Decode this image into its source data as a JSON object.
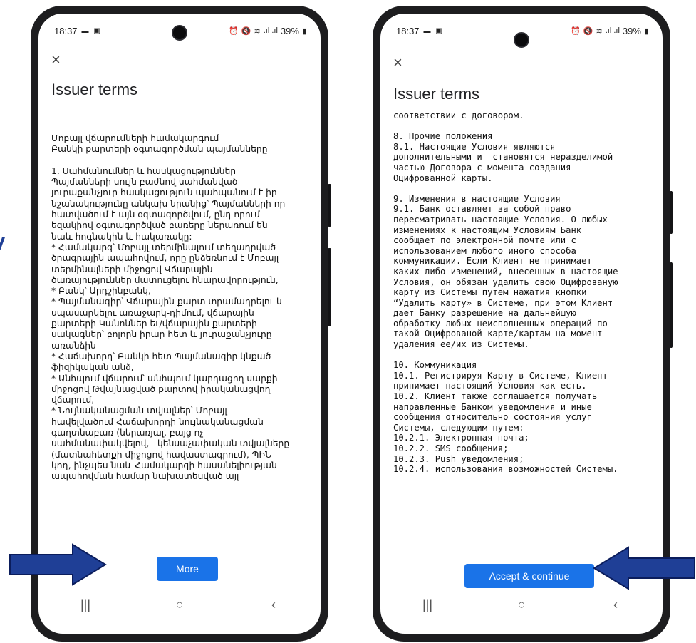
{
  "colors": {
    "accent": "#1a73e8",
    "arrow_fill": "#1f3f96",
    "arrow_stroke": "#0b1d5c"
  },
  "left_phone": {
    "status": {
      "time": "18:37",
      "battery": "39%"
    },
    "close_icon": "×",
    "title": "Issuer terms",
    "body": "Մոբայլ վճարումների համակարգում\nԲանկի քարտերի օգտագործման պայմանները\n\n1. Սահմանումներ և հասկացություններ\nՊայմանների սույն բաժնով սահմանված\nյուրաքանչյուր հասկացություն պահպանում է իր\nնշանակությունը անկախ նրանից՝ Պայմանների որ\nհատվածում է այն օգտագործվում, ընդ որում\nեզակիով օգտագործված բառերը ներառում են\nնաև հոգնակին և հակառակը:\n* Համակարգ՝ Մոբայլ տերմինալում տեղադրված\nծրագրային ապահովում, որը ընձեռնում է Մոբայլ\nտերմինալների միջոցով Վճարային\nծառայություններ մատուցելու հնարավորություն,\n* Բանկ՝ Արդշինբանկ,\n* Պայմանագիր՝ Վճարային քարտ տրամադրելու և\nսպասարկելու առաջարկ-դիմում, վճարային\nքարտերի Կանոններ եւ/վճարային քարտերի\nսակագներ՝ բոլորն իրար հետ և յուրաքանչյուրը\nառանձին\n* Հաճախորդ՝ Բանկի հետ Պայմանագիր կնքած\nֆիզիկական անձ,\n* Անհպում վճարում՝ անհպում կարդացող սարքի\nմիջոցով Թվայնացված քարտով իրականացվող\nվճարում,\n* Նույնականացման տվյալներ՝ Մոբայլ\nհավելվածում Հաճախորդի նույնականացման\nգաղտնաբառ (ներառյալ, բայց ոչ\nսահմանափակվելով,   կենսաչափական տվյալները\n(մատնահետքի միջոցով հավաստագրում), ՊԻՆ\nկոդ, ինչպես նաև Համակարգի հասանելիության\nապահովման համար նախատեսված այլ",
    "button_label": "More",
    "nav": {
      "recents": "|||",
      "home": "○",
      "back": "‹"
    }
  },
  "right_phone": {
    "status": {
      "time": "18:37",
      "battery": "39%"
    },
    "close_icon": "×",
    "title": "Issuer terms",
    "body": "соответствии с договором.\n\n8. Прочие положения\n8.1. Настоящие Условия являются\nдополнительными и  становятся неразделимой\nчастью Договора с момента создания\nОцифрованной карты.\n\n9. Изменения в настоящие Условия\n9.1. Банк оставляет за собой право\nпересматривать настоящие Условия. О любых\nизменениях к настоящим Условиям Банк\nсообщает по электронной почте или с\nиспользованием любого иного способа\nкоммуникации. Если Клиент не принимает\nкаких-либо изменений, внесенных в настоящие\nУсловия, он обязан удалить свою Оцифрованую\nкарту из Системы путем нажатия кнопки\n“Удалить карту» в Системе, при этом Клиент\nдает Банку разрешение на дальнейшую\nобработку любых неисполненных операций по\nтакой Оцифрованой карте/картам на момент\nудаления ее/их из Системы.\n\n10. Коммуникация\n10.1. Регистрируя Карту в Системе, Клиент\nпринимает настоящий Условия как есть.\n10.2. Клиент также соглашается получать\nнаправленные Банком уведомления и иные\nсообщения относительно состояния услуг\nСистемы, следующим путем:\n10.2.1. Электронная почта;\n10.2.2. SMS сообщения;\n10.2.3. Push уведомления;\n10.2.4. использования возможностей Системы.",
    "button_label": "Accept & continue",
    "nav": {
      "recents": "|||",
      "home": "○",
      "back": "‹"
    }
  }
}
